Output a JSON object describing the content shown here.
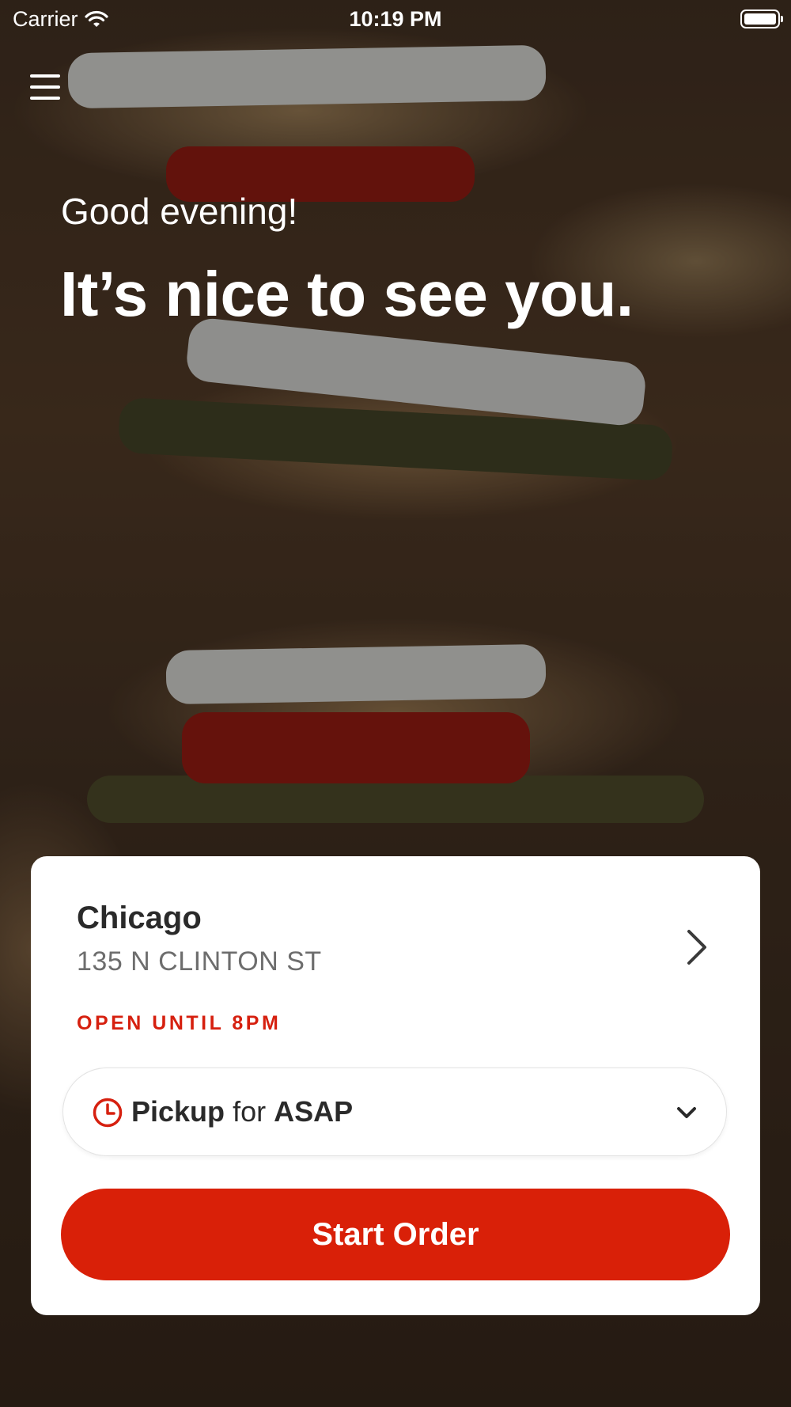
{
  "status_bar": {
    "carrier": "Carrier",
    "time": "10:19 PM"
  },
  "header": {
    "menu_icon": "hamburger-menu-icon"
  },
  "greeting": {
    "salutation": "Good evening!",
    "headline": "It’s nice to see you."
  },
  "location_card": {
    "city": "Chicago",
    "address": "135 N CLINTON ST",
    "open_status": "OPEN UNTIL 8PM",
    "pickup": {
      "mode": "Pickup",
      "connector": "for",
      "time": "ASAP"
    },
    "start_order_label": "Start Order"
  },
  "colors": {
    "accent": "#D92008",
    "open_status": "#D6200F",
    "card_background": "#FFFFFF",
    "text_primary": "#2A2A2A",
    "text_secondary": "#6D6D6D"
  },
  "icons": {
    "wifi": "wifi-icon",
    "battery": "battery-icon",
    "location_chevron": "chevron-right-icon",
    "clock": "clock-icon",
    "dropdown": "chevron-down-icon"
  }
}
